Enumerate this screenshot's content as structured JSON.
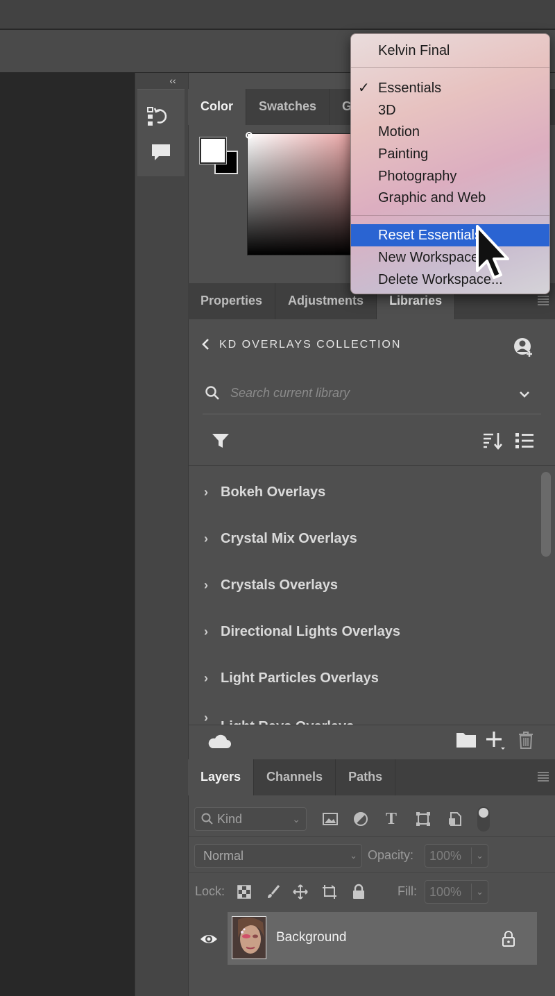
{
  "color_panel": {
    "tabs": [
      "Color",
      "Swatches",
      "G"
    ]
  },
  "workspace_menu": {
    "top_item": "Kelvin Final",
    "checkmark": "✓",
    "items": [
      "Essentials",
      "3D",
      "Motion",
      "Painting",
      "Photography",
      "Graphic and Web"
    ],
    "actions": [
      "Reset Essentials",
      "New Workspace...",
      "Delete Workspace..."
    ],
    "highlighted": "Reset Essentials",
    "highlight_color": "#2a64d2"
  },
  "libraries_panel": {
    "tabs": [
      "Properties",
      "Adjustments",
      "Libraries"
    ],
    "active_tab": "Libraries",
    "collection_title": "KD OVERLAYS COLLECTION",
    "search_placeholder": "Search current library",
    "items": [
      "Bokeh Overlays",
      "Crystal Mix Overlays",
      "Crystals Overlays",
      "Directional Lights Overlays",
      "Light Particles Overlays",
      "Light Rays Overlays"
    ]
  },
  "layers_panel": {
    "tabs": [
      "Layers",
      "Channels",
      "Paths"
    ],
    "active_tab": "Layers",
    "kind_label": "Kind",
    "blend_mode": "Normal",
    "opacity_label": "Opacity:",
    "opacity_value": "100%",
    "lock_label": "Lock:",
    "fill_label": "Fill:",
    "fill_value": "100%",
    "layers": [
      {
        "name": "Background",
        "visible": true,
        "locked": true
      }
    ]
  },
  "colors": {
    "panel_bg": "#4f4f4f",
    "tab_strip": "#3f3f3f",
    "canvas": "#282828"
  }
}
